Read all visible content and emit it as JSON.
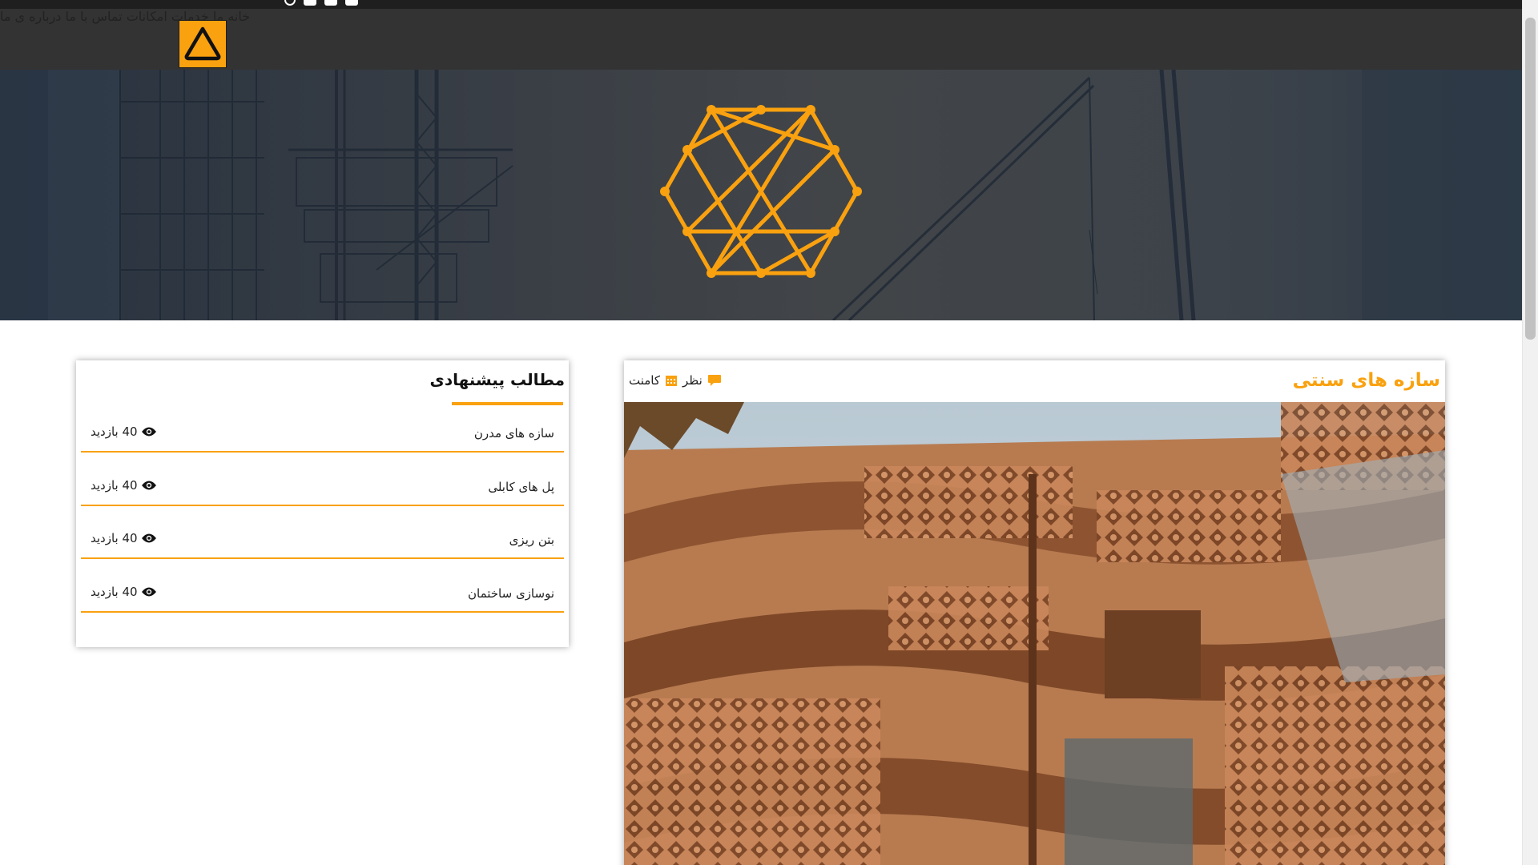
{
  "colors": {
    "accent": "#f9a10f",
    "navbar": "#333333",
    "topstrip": "#1f1f1f"
  },
  "topbar": {
    "info_text": ""
  },
  "navbar": {
    "logo_icon": "warning-triangle-icon",
    "items": [
      {
        "label": "خانه ما"
      },
      {
        "label": "خدمات"
      },
      {
        "label": "امکانات"
      },
      {
        "label": "تماس با ما"
      },
      {
        "label": "درباره ی ما"
      }
    ]
  },
  "hero": {
    "emblem_icon": "hexagon-network-icon",
    "background": "construction-cranes-image"
  },
  "post": {
    "title": "سازه های سنتی",
    "meta_comment_label": "نظر",
    "meta_comment_icon": "comment-icon",
    "meta_calendar_icon": "calendar-icon",
    "meta_comments_text": "کامنت",
    "image": "traditional-building-facade-image"
  },
  "sidebar": {
    "title": "مطالب پیشنهادی",
    "items": [
      {
        "name": "سازه های مدرن",
        "views": "40 بازدید"
      },
      {
        "name": "پل های کابلی",
        "views": "40 بازدید"
      },
      {
        "name": "بتن ریزی",
        "views": "40 بازدید"
      },
      {
        "name": "نوسازی ساختمان",
        "views": "40 بازدید"
      }
    ]
  }
}
